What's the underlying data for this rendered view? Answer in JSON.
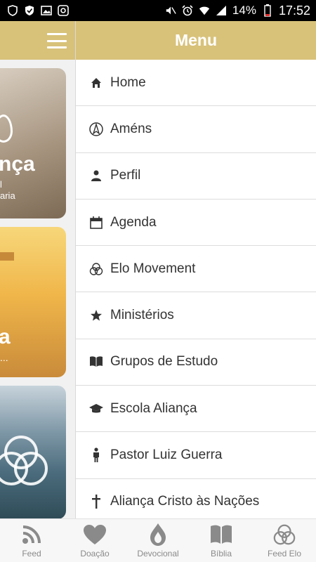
{
  "status_bar": {
    "battery_percent": "14%",
    "time": "17:52",
    "left_icons": [
      "shield-icon",
      "shield-check-icon",
      "image-icon",
      "lock-square-icon"
    ],
    "right_icons": [
      "mute-icon",
      "alarm-icon",
      "wifi-icon",
      "signal-icon",
      "battery-icon"
    ]
  },
  "colors": {
    "accent": "#d8c27a",
    "text": "#333333",
    "tab_inactive": "#8a8a8a",
    "divider": "#dcdcdc"
  },
  "feed": {
    "card1": {
      "title_fragment": "nça",
      "sub_line1": "l",
      "sub_line2": "aria"
    },
    "card2": {
      "title_fragment": "a",
      "sub": "..."
    }
  },
  "menu": {
    "title": "Menu",
    "items": [
      {
        "label": "Home",
        "icon": "home-icon"
      },
      {
        "label": "Améns",
        "icon": "compass-icon"
      },
      {
        "label": "Perfil",
        "icon": "person-icon"
      },
      {
        "label": "Agenda",
        "icon": "calendar-icon"
      },
      {
        "label": "Elo Movement",
        "icon": "elo-rings-icon"
      },
      {
        "label": "Ministérios",
        "icon": "star-icon"
      },
      {
        "label": "Grupos de Estudo",
        "icon": "book-icon"
      },
      {
        "label": "Escola Aliança",
        "icon": "graduation-cap-icon"
      },
      {
        "label": "Pastor Luiz Guerra",
        "icon": "man-icon"
      },
      {
        "label": "Aliança Cristo às Nações",
        "icon": "cross-icon"
      }
    ]
  },
  "tabs": [
    {
      "label": "Feed",
      "icon": "rss-icon"
    },
    {
      "label": "Doação",
      "icon": "heart-icon"
    },
    {
      "label": "Devocional",
      "icon": "flame-drop-icon"
    },
    {
      "label": "Bíblia",
      "icon": "open-book-icon"
    },
    {
      "label": "Feed Elo",
      "icon": "elo-rings-icon"
    }
  ]
}
